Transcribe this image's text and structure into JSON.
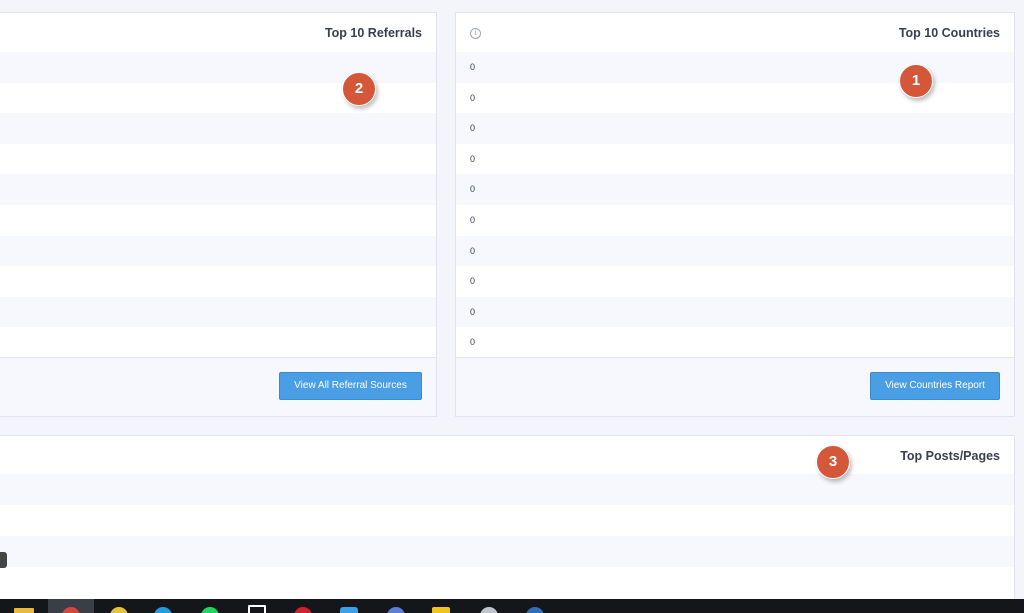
{
  "referrals": {
    "title": "Top 10 Referrals",
    "rows": [
      "",
      "",
      "",
      "",
      "",
      "",
      "",
      "",
      "",
      ""
    ],
    "button_label": "View All Referral Sources"
  },
  "countries": {
    "title": "Top 10 Countries",
    "info_icon": "info-icon",
    "rows": [
      "0",
      "0",
      "0",
      "0",
      "0",
      "0",
      "0",
      "0",
      "0",
      "0"
    ],
    "button_label": "View Countries Report"
  },
  "posts": {
    "title": "Top Posts/Pages",
    "rows": [
      "",
      "",
      "",
      ""
    ]
  },
  "badges": {
    "b1": "1",
    "b2": "2",
    "b3": "3",
    "color": "#d4573a"
  },
  "colors": {
    "accent_button": "#4a9ee4",
    "panel_border": "#dfe4f0",
    "background": "#f3f5fb"
  },
  "taskbar": {
    "icons": [
      "file-explorer-icon",
      "chrome-icon",
      "chrome-canary-icon",
      "skype-icon",
      "spotify-icon",
      "window-icon",
      "opera-icon",
      "store-icon",
      "dev-tool-icon",
      "folder-icon",
      "app-icon",
      "app-icon-2"
    ]
  }
}
